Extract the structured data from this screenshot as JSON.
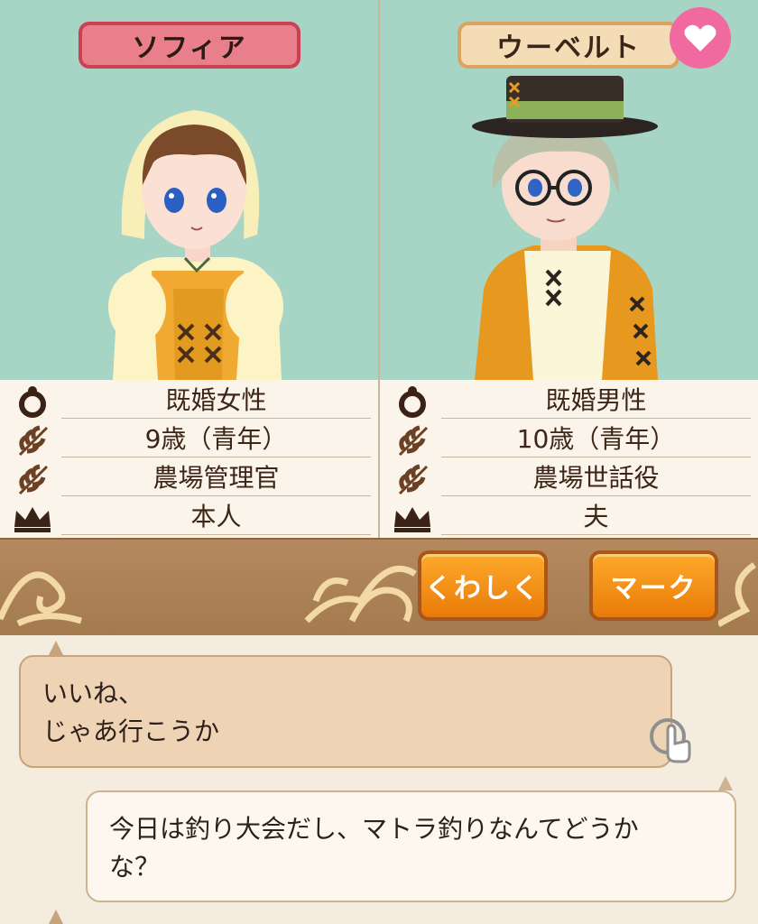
{
  "characters": [
    {
      "name": "ソフィア",
      "marital": "既婚女性",
      "age": "9歳（青年）",
      "job": "農場管理官",
      "relation": "本人"
    },
    {
      "name": "ウーベルト",
      "marital": "既婚男性",
      "age": "10歳（青年）",
      "job": "農場世話役",
      "relation": "夫"
    }
  ],
  "icons": {
    "marital": "ring-icon",
    "age": "leaf-icon",
    "job": "leaf-icon",
    "relation": "crown-icon",
    "favorite": "heart-icon",
    "tap": "tap-hand-icon"
  },
  "actions": {
    "details_label": "くわしく",
    "mark_label": "マーク"
  },
  "chat": {
    "line1": "いいね、",
    "line2": "じゃあ行こうか",
    "line3": "今日は釣り大会だし、マトラ釣りなんてどうか",
    "line4": "な？"
  },
  "colors": {
    "portrait_bg": "#a6d4c5",
    "female_pill": "#e87f8a",
    "male_pill": "#f4dcb7",
    "heart": "#f06aa0",
    "action_button": "#f89a1c",
    "ornate_bar": "#ad8358"
  }
}
